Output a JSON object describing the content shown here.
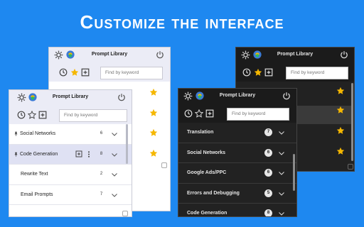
{
  "headline": "Customize the interface",
  "panels": {
    "back_dark": {
      "title": "Prompt Library",
      "search_placeholder": "Find by keyword",
      "stray_text": "...."
    },
    "front_light": {
      "title": "Prompt Library",
      "search_placeholder": "Find by keyword",
      "items": [
        {
          "label": "Social Networks",
          "count": "6"
        },
        {
          "label": "Code Generation",
          "count": "8"
        },
        {
          "label": "Rewrite Text",
          "count": "2"
        },
        {
          "label": "Email Prompts",
          "count": "7"
        }
      ]
    },
    "front_dark": {
      "title": "Prompt Library",
      "search_placeholder": "Find by keyword",
      "items": [
        {
          "label": "Translation",
          "count": "7"
        },
        {
          "label": "Social Networks",
          "count": "6"
        },
        {
          "label": "Google Ads/PPC",
          "count": "6"
        },
        {
          "label": "Errors and Debugging",
          "count": "5"
        },
        {
          "label": "Code Generation",
          "count": "8"
        }
      ]
    },
    "back_light": {
      "title": "Prompt Library"
    }
  },
  "colors": {
    "background": "#1e88f0",
    "star": "#f5b700",
    "highlight_row": "#dfe1f3"
  },
  "icons": [
    "gear-icon",
    "logo-icon",
    "power-icon",
    "clock-icon",
    "star-icon",
    "add-icon",
    "chevron-down-icon",
    "pin-icon",
    "more-icon"
  ]
}
